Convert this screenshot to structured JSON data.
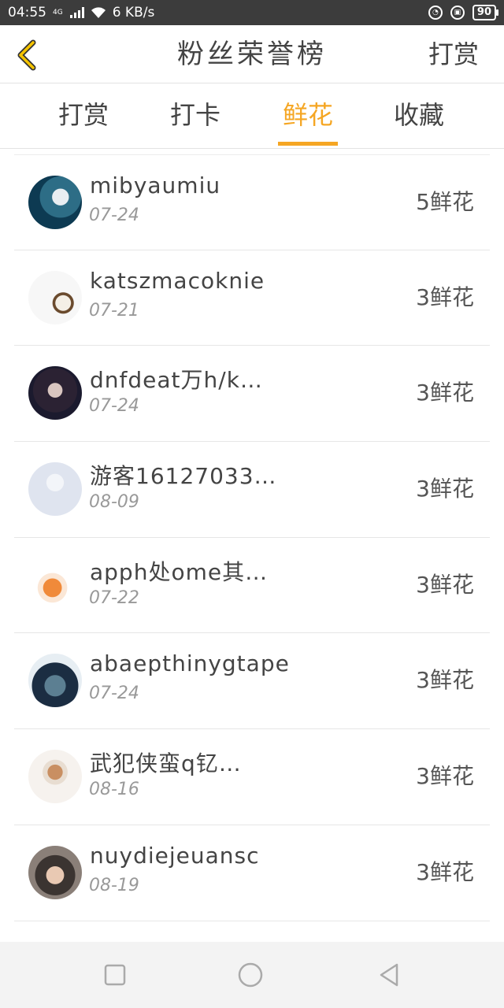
{
  "status": {
    "time": "04:55",
    "net": "4G",
    "speed": "6 KB/s",
    "battery": "90"
  },
  "header": {
    "title": "粉丝荣誉榜",
    "right_action": "打赏"
  },
  "tabs": [
    {
      "label": "打赏",
      "active": false
    },
    {
      "label": "打卡",
      "active": false
    },
    {
      "label": "鲜花",
      "active": true
    },
    {
      "label": "收藏",
      "active": false
    }
  ],
  "accent_color": "#f5a623",
  "list": [
    {
      "name": "mibyaumiu",
      "date": "07-24",
      "count": "5鲜花"
    },
    {
      "name": "katszmacoknie",
      "date": "07-21",
      "count": "3鲜花"
    },
    {
      "name": "dnfdeat万h/k…",
      "date": "07-24",
      "count": "3鲜花"
    },
    {
      "name": "游客16127033…",
      "date": "08-09",
      "count": "3鲜花"
    },
    {
      "name": "apph处ome其…",
      "date": "07-22",
      "count": "3鲜花"
    },
    {
      "name": "abaepthinygtape",
      "date": "07-24",
      "count": "3鲜花"
    },
    {
      "name": "武犯侠蛮q钇…",
      "date": "08-16",
      "count": "3鲜花"
    },
    {
      "name": "nuydiejeuansc",
      "date": "08-19",
      "count": "3鲜花"
    }
  ]
}
